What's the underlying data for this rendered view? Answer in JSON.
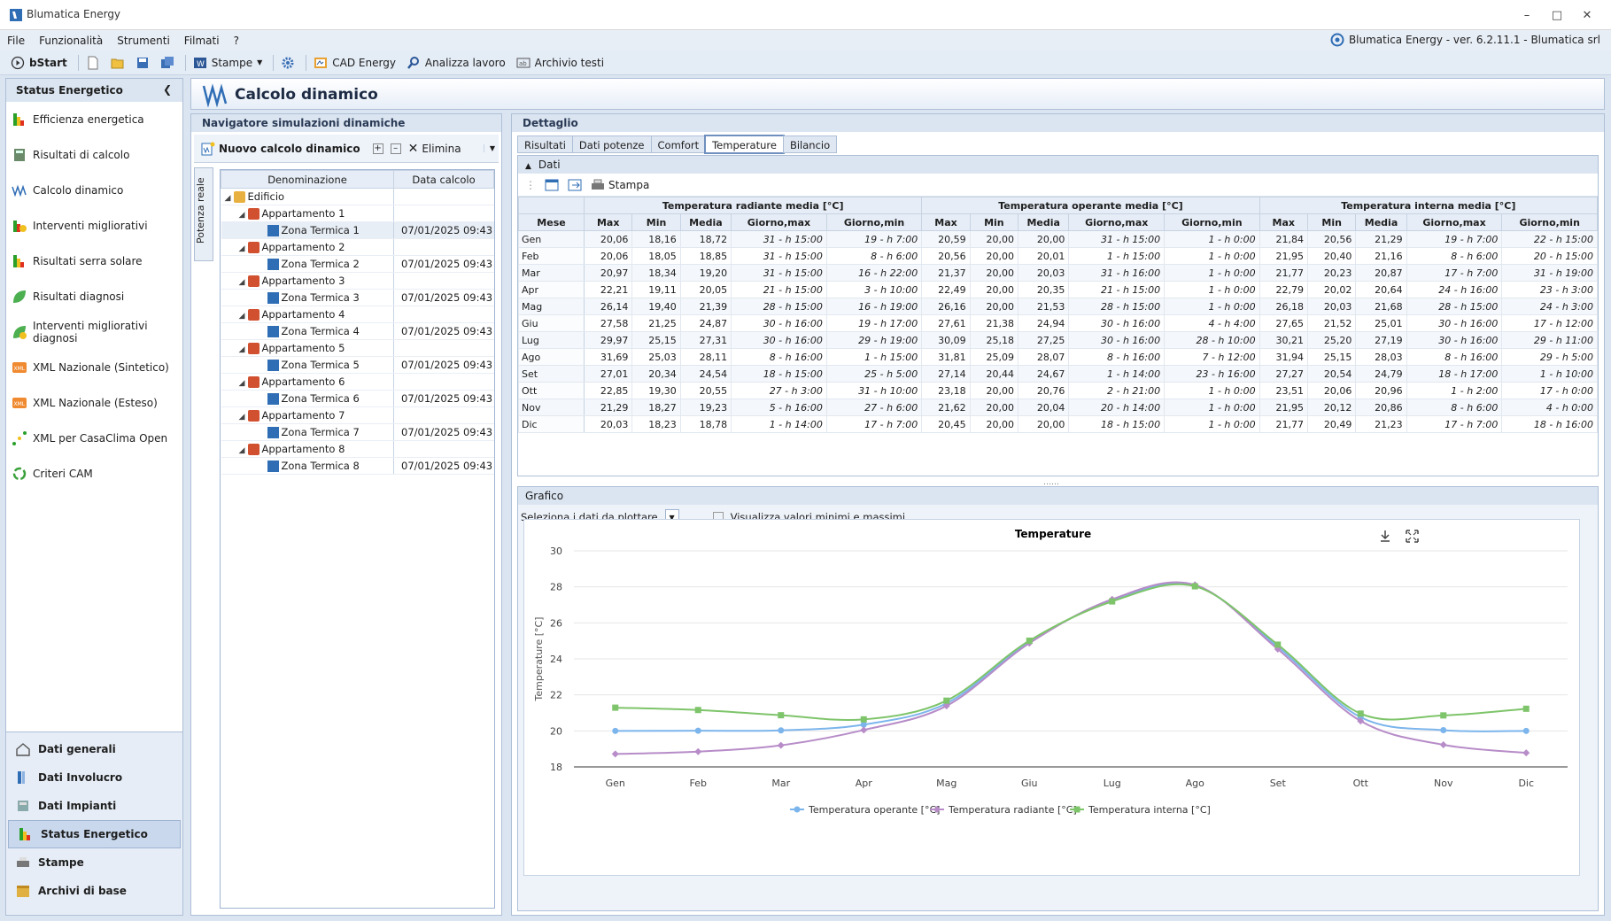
{
  "app": {
    "title": "Blumatica Energy",
    "version_text": "Blumatica Energy - ver. 6.2.11.1 - Blumatica srl"
  },
  "menu": [
    "File",
    "Funzionalità",
    "Strumenti",
    "Filmati",
    "?"
  ],
  "toolbar": {
    "bstart": "bStart",
    "stampe": "Stampe",
    "cad": "CAD Energy",
    "analizza": "Analizza lavoro",
    "archivio": "Archivio testi"
  },
  "left_nav": {
    "header": "Status Energetico",
    "items": [
      "Efficienza energetica",
      "Risultati di calcolo",
      "Calcolo dinamico",
      "Interventi migliorativi",
      "Risultati serra solare",
      "Risultati diagnosi",
      "Interventi migliorativi diagnosi",
      "XML Nazionale (Sintetico)",
      "XML Nazionale (Esteso)",
      "XML per CasaClima Open",
      "Criteri CAM"
    ],
    "bottom": [
      "Dati generali",
      "Dati Involucro",
      "Dati Impianti",
      "Status Energetico",
      "Stampe",
      "Archivi di base"
    ]
  },
  "page_title": "Calcolo dinamico",
  "navigator": {
    "title": "Navigatore simulazioni dinamiche",
    "new_button": "Nuovo calcolo dinamico",
    "delete_button": "Elimina",
    "vertical_tab": "Potenza reale",
    "col_name": "Denominazione",
    "col_date": "Data calcolo",
    "root": "Edificio",
    "apartments": [
      {
        "name": "Appartamento 1",
        "zone": "Zona Termica 1",
        "date": "07/01/2025 09:43"
      },
      {
        "name": "Appartamento 2",
        "zone": "Zona Termica 2",
        "date": "07/01/2025 09:43"
      },
      {
        "name": "Appartamento 3",
        "zone": "Zona Termica 3",
        "date": "07/01/2025 09:43"
      },
      {
        "name": "Appartamento 4",
        "zone": "Zona Termica 4",
        "date": "07/01/2025 09:43"
      },
      {
        "name": "Appartamento 5",
        "zone": "Zona Termica 5",
        "date": "07/01/2025 09:43"
      },
      {
        "name": "Appartamento 6",
        "zone": "Zona Termica 6",
        "date": "07/01/2025 09:43"
      },
      {
        "name": "Appartamento 7",
        "zone": "Zona Termica 7",
        "date": "07/01/2025 09:43"
      },
      {
        "name": "Appartamento 8",
        "zone": "Zona Termica 8",
        "date": "07/01/2025 09:43"
      }
    ]
  },
  "detail": {
    "title": "Dettaglio",
    "tabs": [
      "Risultati",
      "Dati potenze",
      "Comfort",
      "Temperature",
      "Bilancio"
    ],
    "active_tab": "Temperature",
    "data_section": "Dati",
    "print": "Stampa",
    "groups": [
      "Temperatura radiante media [°C]",
      "Temperatura operante media [°C]",
      "Temperatura interna media [°C]"
    ],
    "subcols": [
      "Max",
      "Min",
      "Media",
      "Giorno,max",
      "Giorno,min"
    ],
    "mese": "Mese",
    "rows": [
      [
        "Gen",
        "20,06",
        "18,16",
        "18,72",
        "31 - h 15:00",
        "19 - h 7:00",
        "20,59",
        "20,00",
        "20,00",
        "31 - h 15:00",
        "1 - h 0:00",
        "21,84",
        "20,56",
        "21,29",
        "19 - h 7:00",
        "22 - h 15:00"
      ],
      [
        "Feb",
        "20,06",
        "18,05",
        "18,85",
        "31 - h 15:00",
        "8 - h 6:00",
        "20,56",
        "20,00",
        "20,01",
        "1 - h 15:00",
        "1 - h 0:00",
        "21,95",
        "20,40",
        "21,16",
        "8 - h 6:00",
        "20 - h 15:00"
      ],
      [
        "Mar",
        "20,97",
        "18,34",
        "19,20",
        "31 - h 15:00",
        "16 - h 22:00",
        "21,37",
        "20,00",
        "20,03",
        "31 - h 16:00",
        "1 - h 0:00",
        "21,77",
        "20,23",
        "20,87",
        "17 - h 7:00",
        "31 - h 19:00"
      ],
      [
        "Apr",
        "22,21",
        "19,11",
        "20,05",
        "21 - h 15:00",
        "3 - h 10:00",
        "22,49",
        "20,00",
        "20,35",
        "21 - h 15:00",
        "1 - h 0:00",
        "22,79",
        "20,02",
        "20,64",
        "24 - h 16:00",
        "23 - h 3:00"
      ],
      [
        "Mag",
        "26,14",
        "19,40",
        "21,39",
        "28 - h 15:00",
        "16 - h 19:00",
        "26,16",
        "20,00",
        "21,53",
        "28 - h 15:00",
        "1 - h 0:00",
        "26,18",
        "20,03",
        "21,68",
        "28 - h 15:00",
        "24 - h 3:00"
      ],
      [
        "Giu",
        "27,58",
        "21,25",
        "24,87",
        "30 - h 16:00",
        "19 - h 17:00",
        "27,61",
        "21,38",
        "24,94",
        "30 - h 16:00",
        "4 - h 4:00",
        "27,65",
        "21,52",
        "25,01",
        "30 - h 16:00",
        "17 - h 12:00"
      ],
      [
        "Lug",
        "29,97",
        "25,15",
        "27,31",
        "30 - h 16:00",
        "29 - h 19:00",
        "30,09",
        "25,18",
        "27,25",
        "30 - h 16:00",
        "28 - h 10:00",
        "30,21",
        "25,20",
        "27,19",
        "30 - h 16:00",
        "29 - h 11:00"
      ],
      [
        "Ago",
        "31,69",
        "25,03",
        "28,11",
        "8 - h 16:00",
        "1 - h 15:00",
        "31,81",
        "25,09",
        "28,07",
        "8 - h 16:00",
        "7 - h 12:00",
        "31,94",
        "25,15",
        "28,03",
        "8 - h 16:00",
        "29 - h 5:00"
      ],
      [
        "Set",
        "27,01",
        "20,34",
        "24,54",
        "18 - h 15:00",
        "25 - h 5:00",
        "27,14",
        "20,44",
        "24,67",
        "1 - h 14:00",
        "23 - h 16:00",
        "27,27",
        "20,54",
        "24,79",
        "18 - h 17:00",
        "1 - h 10:00"
      ],
      [
        "Ott",
        "22,85",
        "19,30",
        "20,55",
        "27 - h 3:00",
        "31 - h 10:00",
        "23,18",
        "20,00",
        "20,76",
        "2 - h 21:00",
        "1 - h 0:00",
        "23,51",
        "20,06",
        "20,96",
        "1 - h 2:00",
        "17 - h 0:00"
      ],
      [
        "Nov",
        "21,29",
        "18,27",
        "19,23",
        "5 - h 16:00",
        "27 - h 6:00",
        "21,62",
        "20,00",
        "20,04",
        "20 - h 14:00",
        "1 - h 0:00",
        "21,95",
        "20,12",
        "20,86",
        "8 - h 6:00",
        "4 - h 0:00"
      ],
      [
        "Dic",
        "20,03",
        "18,23",
        "18,78",
        "1 - h 14:00",
        "17 - h 7:00",
        "20,45",
        "20,00",
        "20,00",
        "18 - h 15:00",
        "1 - h 0:00",
        "21,77",
        "20,49",
        "21,23",
        "17 - h 7:00",
        "18 - h 16:00"
      ]
    ],
    "graph_section": "Grafico",
    "plot_select_label": "Seleziona i dati da plottare",
    "minmax_checkbox": "Visualizza valori minimi e massimi"
  },
  "chart_data": {
    "type": "line",
    "title": "Temperature",
    "ylabel": "Temperature [°C]",
    "xlabel": "",
    "ylim": [
      18,
      30
    ],
    "yticks": [
      18,
      20,
      22,
      24,
      26,
      28,
      30
    ],
    "categories": [
      "Gen",
      "Feb",
      "Mar",
      "Apr",
      "Mag",
      "Giu",
      "Lug",
      "Ago",
      "Set",
      "Ott",
      "Nov",
      "Dic"
    ],
    "legend_position": "bottom",
    "series": [
      {
        "name": "Temperatura operante [°C]",
        "color": "#7cb5ec",
        "marker": "circle",
        "values": [
          20.0,
          20.01,
          20.03,
          20.35,
          21.53,
          24.94,
          27.25,
          28.07,
          24.67,
          20.76,
          20.04,
          20.0
        ]
      },
      {
        "name": "Temperatura radiante [°C]",
        "color": "#b78cc8",
        "marker": "diamond",
        "values": [
          18.72,
          18.85,
          19.2,
          20.05,
          21.39,
          24.87,
          27.31,
          28.11,
          24.54,
          20.55,
          19.23,
          18.78
        ]
      },
      {
        "name": "Temperatura interna [°C]",
        "color": "#7ec46a",
        "marker": "square",
        "values": [
          21.29,
          21.16,
          20.87,
          20.64,
          21.68,
          25.01,
          27.19,
          28.03,
          24.79,
          20.96,
          20.86,
          21.23
        ]
      }
    ]
  }
}
